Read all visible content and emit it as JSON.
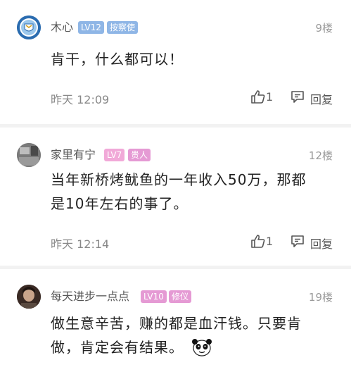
{
  "comments": [
    {
      "username": "木心",
      "level": "LV12",
      "tag": "按察使",
      "floor": "9楼",
      "text": "肯干，什么都可以！",
      "time": "昨天 12:09",
      "likes": "1",
      "reply_label": "回复",
      "level_color": "#8fb6e6",
      "tag_color": "#8fb6e6"
    },
    {
      "username": "家里有宁",
      "level": "LV7",
      "tag": "贵人",
      "floor": "12楼",
      "text_lines": [
        "当年新桥烤鱿鱼的一年收入50万，那都",
        "是10年左右的事了。"
      ],
      "time": "昨天 12:14",
      "likes": "1",
      "reply_label": "回复",
      "level_color": "#f1a9d8",
      "tag_color": "#e59ad4"
    },
    {
      "username": "每天进步一点点",
      "level": "LV10",
      "tag": "修仪",
      "floor": "19楼",
      "text_lines": [
        "做生意辛苦，赚的都是血汗钱。只要肯",
        "做，肯定会有结果。"
      ],
      "emoji": "panda-face",
      "level_color": "#e59ad4",
      "tag_color": "#e59ad4"
    }
  ]
}
